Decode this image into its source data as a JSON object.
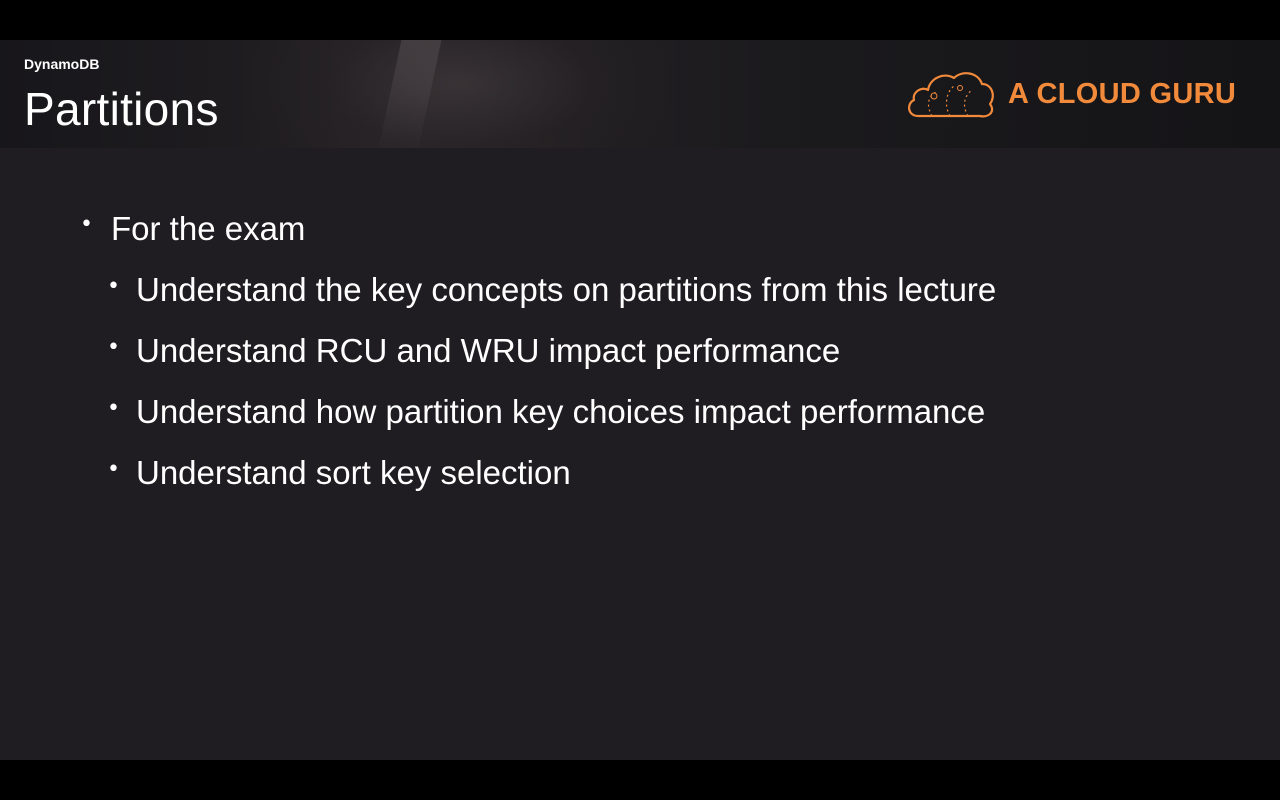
{
  "header": {
    "section_label": "DynamoDB",
    "title": "Partitions",
    "brand_name": "A CLOUD GURU",
    "brand_icon": "cloud-logo-icon",
    "brand_color": "#f28a3c"
  },
  "content": {
    "bullet_main": "For the exam",
    "sub_bullets": [
      "Understand the key concepts on partitions from this lecture",
      "Understand RCU and WRU impact performance",
      "Understand how partition key choices impact performance",
      "Understand sort key selection"
    ]
  },
  "colors": {
    "background": "#1f1d21",
    "text": "#ffffff",
    "letterbox": "#000000"
  }
}
